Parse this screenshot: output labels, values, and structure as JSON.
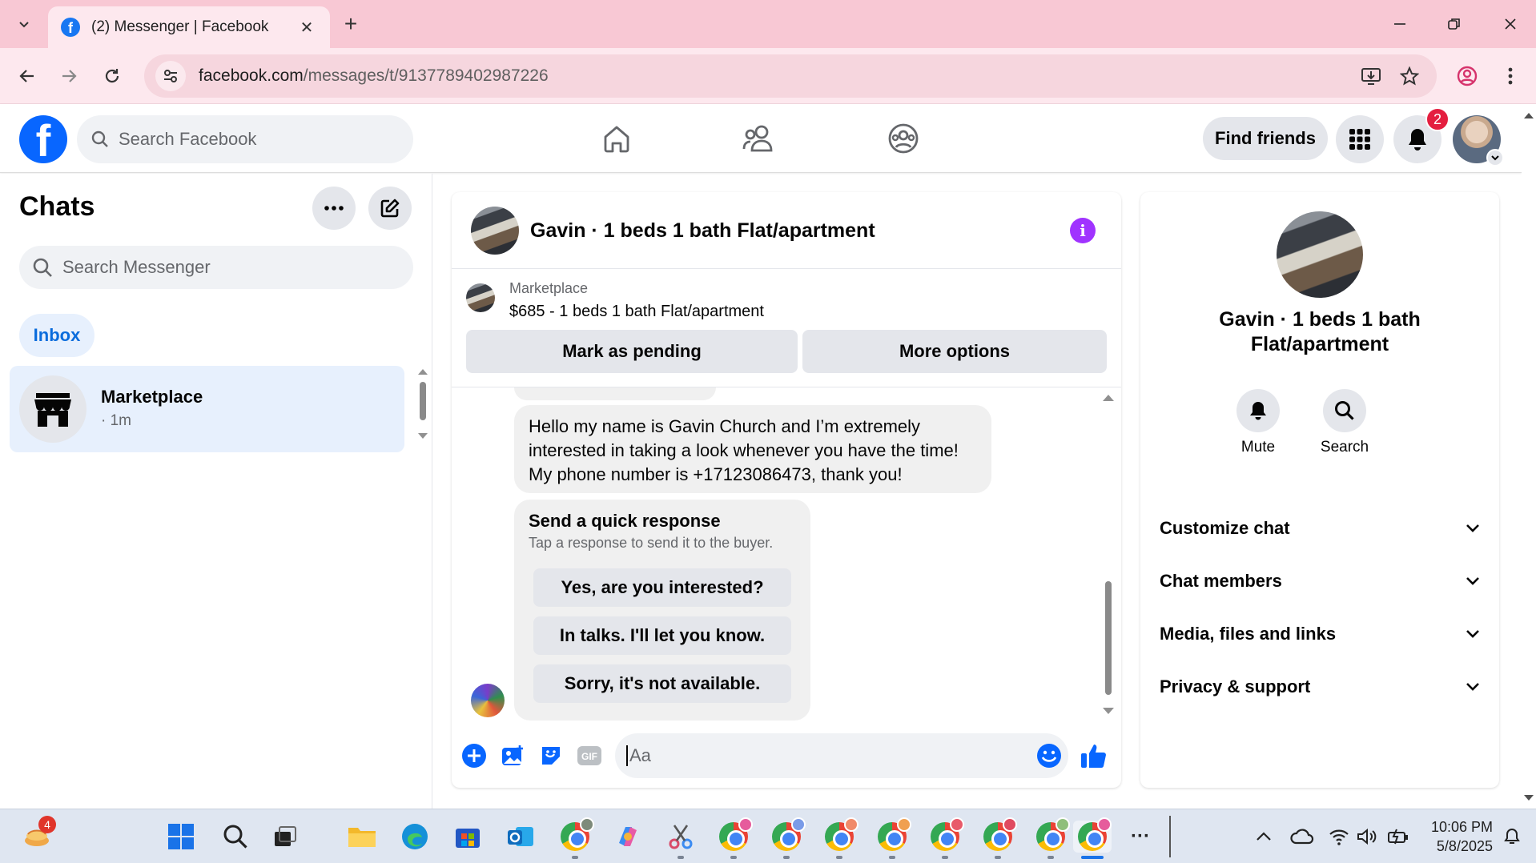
{
  "browser": {
    "tab_title": "(2) Messenger | Facebook",
    "tab_close": "✕",
    "new_tab": "+",
    "url_host": "facebook.com",
    "url_path": "/messages/t/9137789402987226"
  },
  "fb_header": {
    "logo_letter": "f",
    "search_placeholder": "Search Facebook",
    "find_friends_label": "Find friends",
    "notification_count": "2"
  },
  "chats": {
    "title": "Chats",
    "search_placeholder": "Search Messenger",
    "inbox_label": "Inbox",
    "items": [
      {
        "name": "Marketplace",
        "time": "· 1m"
      }
    ]
  },
  "conversation": {
    "title": "Gavin · 1 beds 1 bath Flat/apartment",
    "info_glyph": "i",
    "listing": {
      "label": "Marketplace",
      "price_line": "$685 - 1 beds 1 bath Flat/apartment",
      "mark_pending_label": "Mark as pending",
      "more_options_label": "More options"
    },
    "message_text": "Hello my name is Gavin Church and I’m extremely interested in taking a look whenever you have the time! My phone number is +17123086473, thank you!",
    "quick_response": {
      "title": "Send a quick response",
      "subtitle": "Tap a response to send it to the buyer.",
      "options": [
        "Yes, are you interested?",
        "In talks. I'll let you know.",
        "Sorry, it's not available."
      ]
    },
    "composer_placeholder": "Aa"
  },
  "info_panel": {
    "name": "Gavin · 1 beds 1 bath Flat/apartment",
    "actions": [
      {
        "label": "Mute",
        "icon": "bell-icon"
      },
      {
        "label": "Search",
        "icon": "search-icon"
      }
    ],
    "sections": [
      "Customize chat",
      "Chat members",
      "Media, files and links",
      "Privacy & support"
    ]
  },
  "taskbar": {
    "widget_badge": "4",
    "more_glyph": "···",
    "time": "10:06 PM",
    "date": "5/8/2025"
  },
  "colors": {
    "fb_blue": "#0866ff",
    "badge_red": "#e41e3f",
    "info_purple": "#a033ff",
    "tab_strip": "#f8c8d4",
    "selected_chat": "#e7f0fd"
  }
}
